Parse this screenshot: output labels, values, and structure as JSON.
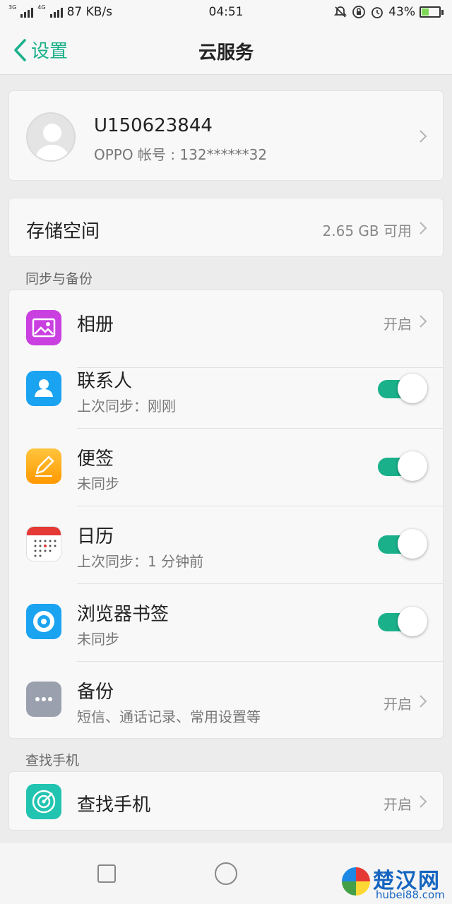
{
  "status_bar": {
    "net_top": "3G",
    "net_top2": "4G",
    "speed": "87 KB/s",
    "time": "04:51",
    "battery": "43%",
    "battery_level": 0.43
  },
  "nav": {
    "back_label": "设置",
    "title": "云服务"
  },
  "account": {
    "username": "U150623844",
    "account_line": "OPPO 帐号 : 132******32"
  },
  "storage": {
    "label": "存储空间",
    "value": "2.65 GB 可用"
  },
  "sync_section": {
    "header": "同步与备份",
    "items": [
      {
        "title": "相册",
        "value": "开启",
        "icon": "photo-album-icon",
        "color": "#c93fe0"
      },
      {
        "title": "联系人",
        "subtitle": "上次同步：刚刚",
        "toggle": true,
        "icon": "contacts-icon",
        "color": "#1aa3f0"
      },
      {
        "title": "便签",
        "subtitle": "未同步",
        "toggle": true,
        "icon": "notes-icon",
        "color": "#ffa21a"
      },
      {
        "title": "日历",
        "subtitle": "上次同步：1 分钟前",
        "toggle": true,
        "icon": "calendar-icon",
        "color": "#e53935"
      },
      {
        "title": "浏览器书签",
        "subtitle": "未同步",
        "toggle": true,
        "icon": "browser-icon",
        "color": "#1aa3f0"
      },
      {
        "title": "备份",
        "subtitle": "短信、通话记录、常用设置等",
        "value": "开启",
        "icon": "backup-icon",
        "color": "#9aa0ad"
      }
    ]
  },
  "find_section": {
    "header": "查找手机",
    "item": {
      "title": "查找手机",
      "value": "开启",
      "icon": "find-phone-icon",
      "color": "#21c4b0"
    }
  },
  "watermark": {
    "name": "楚汉网",
    "url": "hubei88.com"
  },
  "accent_color": "#1ab08a"
}
